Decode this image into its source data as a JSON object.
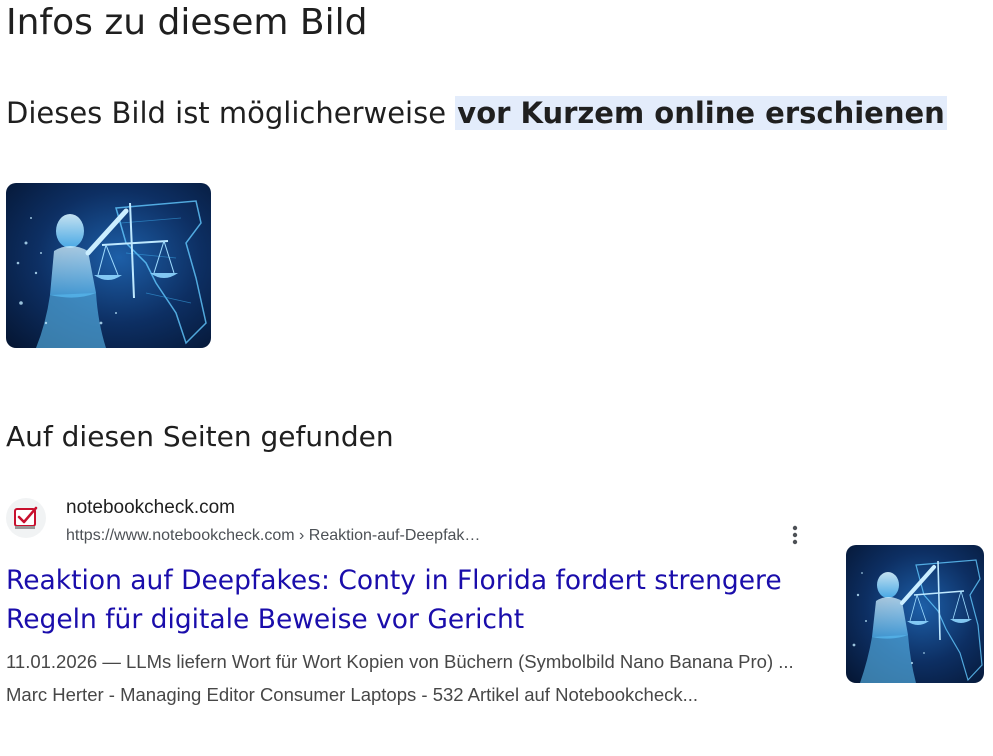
{
  "page": {
    "title": "Infos zu diesem Bild",
    "subtitle_prefix": "Dieses Bild ist möglicherweise ",
    "subtitle_highlight": "vor Kurzem online erschienen",
    "section_heading": "Auf diesen Seiten gefunden"
  },
  "result": {
    "site_name": "notebookcheck.com",
    "url": "https://www.notebookcheck.com › Reaktion-auf-Deepfak…",
    "title": "Reaktion auf Deepfakes: Conty in Florida fordert strengere Regeln für digitale Beweise vor Gericht",
    "snippet": "11.01.2026 — LLMs liefern Wort für Wort Kopien von Büchern (Symbolbild Nano Banana Pro) ... Marc Herter - Managing Editor Consumer Laptops - 532 Artikel auf Notebookcheck...",
    "favicon_icon": "notebookcheck-logo-icon",
    "menu_icon": "more-vert-icon"
  },
  "colors": {
    "link": "#1a0dab",
    "highlight_bg": "#e3ecfb",
    "text": "#1f1f1f",
    "secondary_text": "#4d5156",
    "snippet_text": "#474747"
  }
}
